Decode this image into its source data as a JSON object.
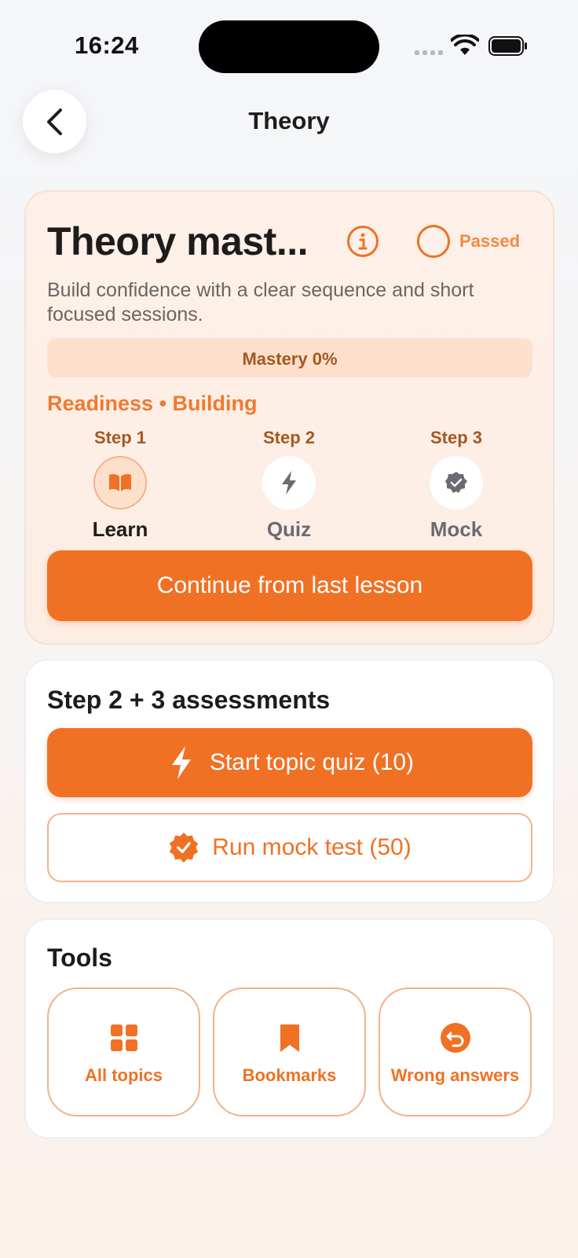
{
  "status_bar": {
    "time": "16:24"
  },
  "header": {
    "title": "Theory"
  },
  "hero": {
    "title": "Theory mast...",
    "passed_label": "Passed",
    "description": "Build confidence with a clear sequence and short focused sessions.",
    "mastery_text": "Mastery 0%",
    "mastery_percent": 0,
    "readiness": "Readiness • Building",
    "steps": [
      {
        "label": "Step 1",
        "name": "Learn",
        "icon": "book-icon",
        "active": true
      },
      {
        "label": "Step 2",
        "name": "Quiz",
        "icon": "bolt-icon",
        "active": false
      },
      {
        "label": "Step 3",
        "name": "Mock",
        "icon": "seal-check-icon",
        "active": false
      }
    ],
    "continue_label": "Continue from last lesson"
  },
  "assessments": {
    "heading": "Step 2 + 3 assessments",
    "quiz_label": "Start topic quiz (10)",
    "mock_label": "Run mock test (50)"
  },
  "tools": {
    "heading": "Tools",
    "items": [
      {
        "label": "All topics",
        "icon": "grid-icon"
      },
      {
        "label": "Bookmarks",
        "icon": "bookmark-icon"
      },
      {
        "label": "Wrong answers",
        "icon": "undo-icon"
      }
    ]
  },
  "colors": {
    "accent": "#f07124",
    "accent_light": "#fde0cc",
    "step_label": "#a4581f"
  }
}
